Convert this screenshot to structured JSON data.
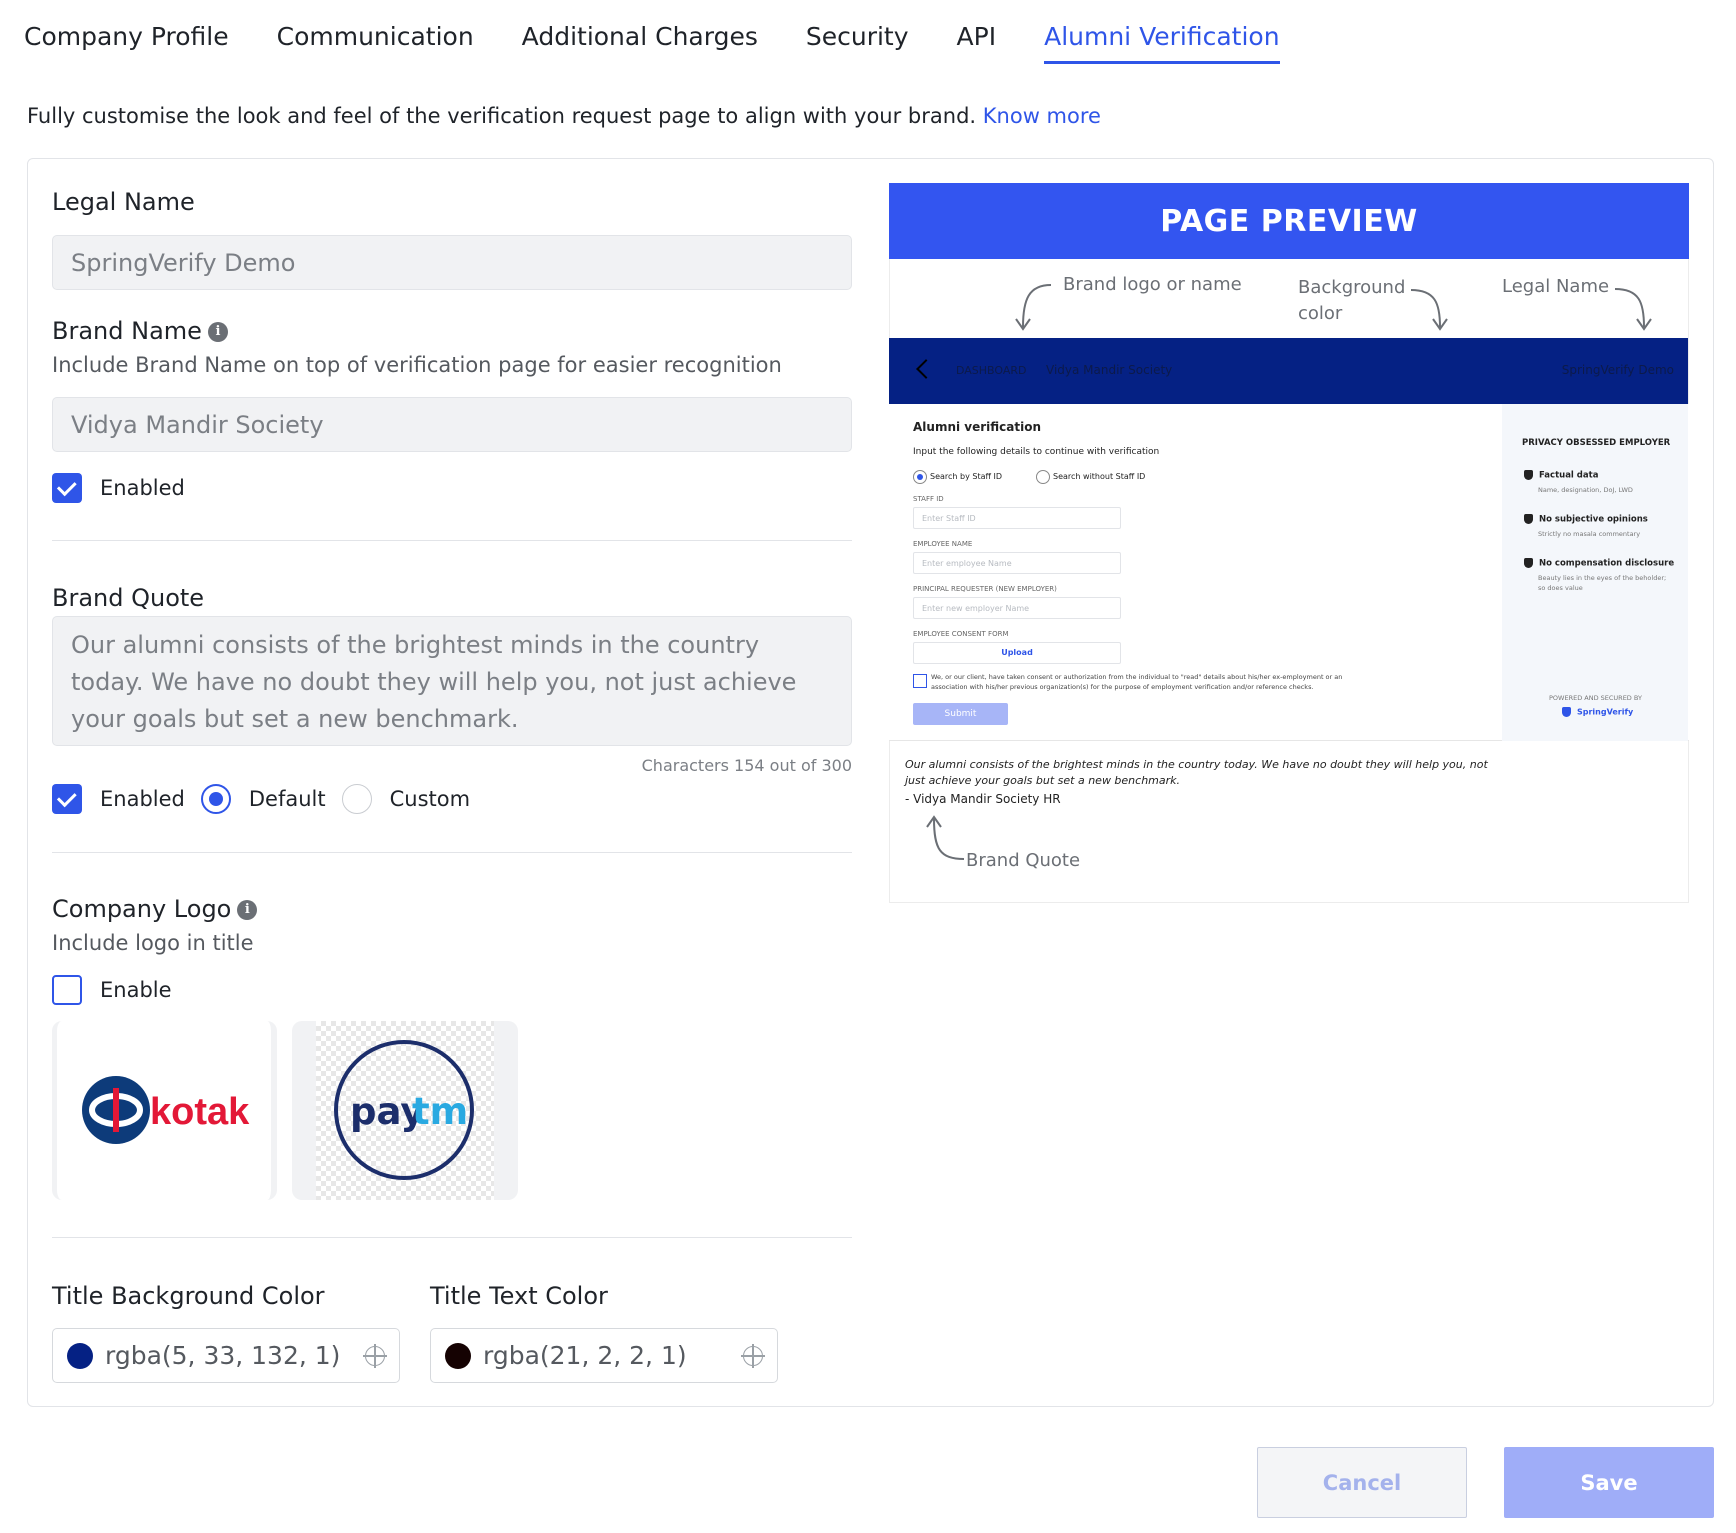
{
  "tabs": [
    {
      "label": "Company Profile",
      "active": false
    },
    {
      "label": "Communication",
      "active": false
    },
    {
      "label": "Additional Charges",
      "active": false
    },
    {
      "label": "Security",
      "active": false
    },
    {
      "label": "API",
      "active": false
    },
    {
      "label": "Alumni Verification",
      "active": true
    }
  ],
  "intro": {
    "text": "Fully customise the look and feel of the verification request page to align with your brand.",
    "link": "Know more"
  },
  "legal_name": {
    "label": "Legal Name",
    "value": "SpringVerify Demo"
  },
  "brand_name": {
    "label": "Brand Name",
    "help": "Include Brand Name on top of verification page for easier recognition",
    "value": "Vidya Mandir Society",
    "enabled_label": "Enabled",
    "enabled": true
  },
  "brand_quote": {
    "label": "Brand Quote",
    "value": "Our alumni consists of the brightest minds in the country today. We have no doubt they will help you, not just achieve your goals but set a new benchmark.",
    "counter": "Characters 154 out of 300",
    "enabled_label": "Enabled",
    "enabled": true,
    "options": [
      "Default",
      "Custom"
    ],
    "selected": "Default"
  },
  "company_logo": {
    "label": "Company Logo",
    "help": "Include logo in title",
    "enable_label": "Enable",
    "enabled": false,
    "logos": [
      {
        "name": "kotak",
        "text": "kotak"
      },
      {
        "name": "paytm",
        "text_a": "pay",
        "text_b": "tm"
      }
    ]
  },
  "title_bg_color": {
    "label": "Title Background Color",
    "value": "rgba(5, 33, 132, 1)",
    "swatch": "#052184"
  },
  "title_text_color": {
    "label": "Title Text Color",
    "value": "rgba(21, 2, 2, 1)",
    "swatch": "#150202"
  },
  "preview": {
    "header": "PAGE PREVIEW",
    "annotations": {
      "brand_logo": "Brand logo or name",
      "background": "Background",
      "background2": "color",
      "legal_name": "Legal Name",
      "brand_quote": "Brand Quote"
    },
    "nav": {
      "crumb": "DASHBOARD",
      "brand": "Vidya Mandir Society",
      "legal": "SpringVerify Demo"
    },
    "form": {
      "title": "Alumni verification",
      "instructions": "Input the following details to continue with verification",
      "radio_staff": "Search by Staff ID",
      "radio_no_staff": "Search without Staff ID",
      "staff_id_label": "STAFF ID",
      "staff_id_placeholder": "Enter Staff ID",
      "employee_name_label": "EMPLOYEE NAME",
      "employee_name_placeholder": "Enter employee Name",
      "requester_label": "PRINCIPAL REQUESTER (NEW EMPLOYER)",
      "requester_placeholder": "Enter new employer Name",
      "consent_label": "EMPLOYEE CONSENT FORM",
      "upload": "Upload",
      "consent_text_1": "We, or our client, have taken consent or authorization from the individual to \"read\" details about his/her ex-employment or an",
      "consent_text_2": "association with his/her previous organization(s) for the purpose of employment verification and/or reference checks.",
      "submit": "Submit"
    },
    "side": {
      "title": "PRIVACY OBSESSED EMPLOYER",
      "items": [
        {
          "title": "Factual data",
          "desc": "Name, designation, DoJ, LWD"
        },
        {
          "title": "No subjective opinions",
          "desc": "Strictly no masala commentary"
        },
        {
          "title": "No compensation disclosure",
          "desc": "Beauty lies in the eyes of the beholder;",
          "desc2": "so does value"
        }
      ],
      "powered": "POWERED AND SECURED BY",
      "brand": "SpringVerify"
    },
    "quote_text": "Our alumni consists of the brightest minds in the country today. We have no doubt they will help you, not just achieve your goals but set a new benchmark.",
    "quote_by": "- Vidya Mandir Society HR"
  },
  "buttons": {
    "cancel": "Cancel",
    "save": "Save"
  },
  "colors": {
    "accent": "#2f55e8",
    "preview_header": "#3355f0",
    "nav_bg": "#052184"
  }
}
